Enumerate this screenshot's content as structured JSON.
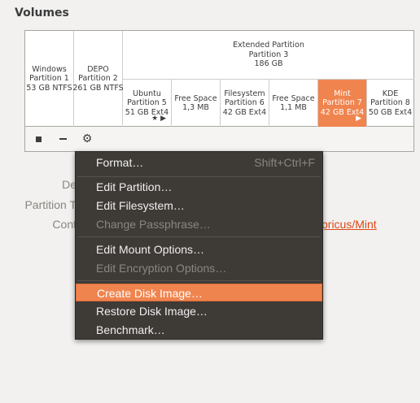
{
  "section_title": "Volumes",
  "partitions": [
    {
      "lines": [
        "Windows",
        "Partition 1",
        "53 GB NTFS"
      ]
    },
    {
      "lines": [
        "DEPO",
        "Partition 2",
        "261 GB NTFS"
      ]
    }
  ],
  "extended": {
    "lines": [
      "Extended Partition",
      "Partition 3",
      "186 GB"
    ]
  },
  "sub_partitions": [
    {
      "lines": [
        "Ubuntu",
        "Partition 5",
        "51 GB Ext4"
      ],
      "icons": "★ ▶"
    },
    {
      "lines": [
        "Free Space",
        "1,3 MB"
      ]
    },
    {
      "lines": [
        "Filesystem",
        "Partition 6",
        "42 GB Ext4"
      ]
    },
    {
      "lines": [
        "Free Space",
        "1,1 MB"
      ]
    },
    {
      "lines": [
        "Mint",
        "Partition 7",
        "42 GB Ext4"
      ],
      "icons": "▶",
      "selected": true
    },
    {
      "lines": [
        "KDE",
        "Partition 8",
        "50 GB Ext4"
      ]
    }
  ],
  "toolbar": {
    "icons": [
      "stop-icon",
      "minus-icon",
      "gear-icon"
    ],
    "gear_glyph": "⚙"
  },
  "background_labels": {
    "label_1": "De",
    "label_2": "Partition T",
    "label_3": "Cont",
    "link": "pricus/Mint"
  },
  "menu": {
    "items": [
      {
        "label": "Format…",
        "accel": "Shift+Ctrl+F",
        "enabled": true
      },
      {
        "label": "Edit Partition…",
        "enabled": true
      },
      {
        "label": "Edit Filesystem…",
        "enabled": true
      },
      {
        "label": "Change Passphrase…",
        "enabled": false
      },
      {
        "label": "Edit Mount Options…",
        "enabled": true
      },
      {
        "label": "Edit Encryption Options…",
        "enabled": false
      },
      {
        "label": "Create Disk Image…",
        "enabled": true,
        "highlighted": true
      },
      {
        "label": "Restore Disk Image…",
        "enabled": true
      },
      {
        "label": "Benchmark…",
        "enabled": true
      }
    ]
  },
  "colors": {
    "accent": "#f0844f",
    "menu_bg": "#3e3b37",
    "link": "#dd4814"
  }
}
